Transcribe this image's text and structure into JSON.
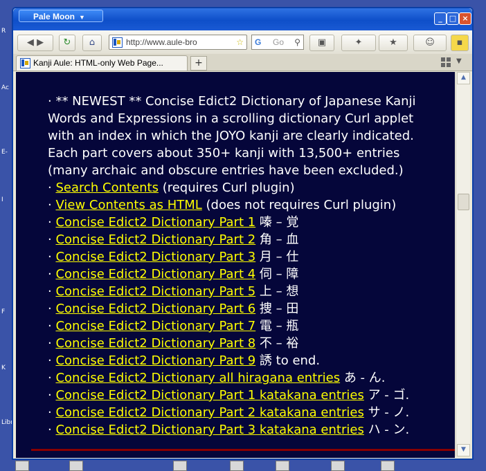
{
  "desktop": {
    "side_labels": [
      "R",
      "Ac",
      "E-",
      "I",
      "F",
      "K",
      "Libr"
    ]
  },
  "window": {
    "app_button": "Pale Moon",
    "controls": {
      "minimize": "_",
      "maximize": "□",
      "close": "×"
    }
  },
  "toolbar": {
    "url": "http://www.aule-bro",
    "search_placeholder": "Go",
    "back_icon": "back-arrow",
    "forward_icon": "forward-arrow",
    "reload_icon": "reload",
    "home_icon": "home"
  },
  "tab": {
    "title": "Kanji Aule: HTML-only Web Page...",
    "newtab_label": "+"
  },
  "page": {
    "intro": "· ** NEWEST ** Concise Edict2 Dictionary of Japanese Kanji Words and Expressions in a scrolling dictionary Curl applet with an index in which the JOYO kanji are clearly indicated. Each part covers about 350+ kanji with 13,500+ entries (many archaic and obscure entries have been excluded.)",
    "links": [
      {
        "prefix": "· ",
        "link": "Search Contents",
        "suffix": " (requires Curl plugin)"
      },
      {
        "prefix": "· ",
        "link": "View Contents as HTML",
        "suffix": " (does not requires Curl plugin)"
      },
      {
        "prefix": "· ",
        "link": "Concise Edict2 Dictionary Part 1",
        "suffix": " 嗪 – 覚"
      },
      {
        "prefix": "· ",
        "link": "Concise Edict2 Dictionary Part 2",
        "suffix": " 角 – 血"
      },
      {
        "prefix": "· ",
        "link": "Concise Edict2 Dictionary Part 3",
        "suffix": " 月 – 仕"
      },
      {
        "prefix": "· ",
        "link": "Concise Edict2 Dictionary Part 4",
        "suffix": " 伺 – 障"
      },
      {
        "prefix": "· ",
        "link": "Concise Edict2 Dictionary Part 5",
        "suffix": " 上 – 想"
      },
      {
        "prefix": "· ",
        "link": "Concise Edict2 Dictionary Part 6",
        "suffix": " 捜 – 田"
      },
      {
        "prefix": "· ",
        "link": "Concise Edict2 Dictionary Part 7",
        "suffix": " 電 – 瓶"
      },
      {
        "prefix": "· ",
        "link": "Concise Edict2 Dictionary Part 8",
        "suffix": " 不 – 裕"
      },
      {
        "prefix": "· ",
        "link": "Concise Edict2 Dictionary Part 9",
        "suffix": " 誘 to end."
      },
      {
        "prefix": "· ",
        "link": "Concise Edict2 Dictionary all hiragana entries",
        "suffix": " あ - ん."
      },
      {
        "prefix": "· ",
        "link": "Concise Edict2 Dictionary Part 1 katakana entries",
        "suffix": " ア - ゴ."
      },
      {
        "prefix": "· ",
        "link": "Concise Edict2 Dictionary Part 2 katakana entries",
        "suffix": " サ - ノ."
      },
      {
        "prefix": "· ",
        "link": "Concise Edict2 Dictionary Part 3 katakana entries",
        "suffix": " ハ - ン."
      }
    ]
  }
}
